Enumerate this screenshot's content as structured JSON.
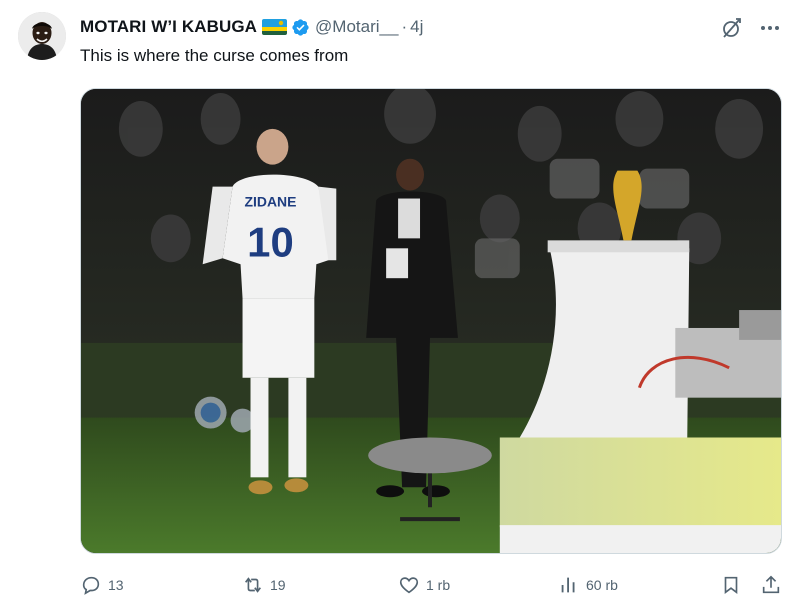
{
  "tweet": {
    "author_name": "MOTARI W’I KABUGA",
    "handle": "@Motari__",
    "separator": "·",
    "time": "4j",
    "text": "This is where the curse comes from",
    "verified_color": "#1d9bf0"
  },
  "media": {
    "jersey_name": "ZIDANE",
    "jersey_number": "10"
  },
  "actions": {
    "replies": "13",
    "reposts": "19",
    "likes": "1 rb",
    "views": "60 rb"
  },
  "icons": [
    "grok-icon",
    "more-icon",
    "reply-icon",
    "repost-icon",
    "like-icon",
    "views-icon",
    "bookmark-icon",
    "share-icon"
  ]
}
